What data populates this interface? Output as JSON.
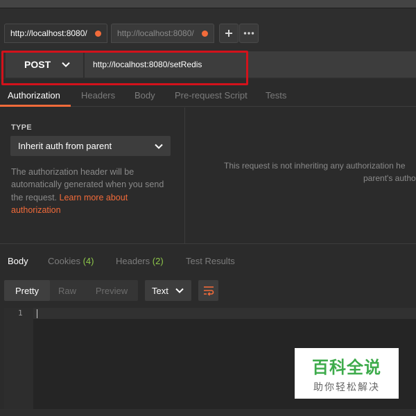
{
  "tabs": [
    {
      "label": "http://localhost:8080/",
      "active": true,
      "unsaved": true
    },
    {
      "label": "http://localhost:8080/",
      "active": false,
      "unsaved": true
    }
  ],
  "tab_actions": {
    "new_tab_icon": "plus-icon",
    "more_icon": "ellipsis-icon"
  },
  "request": {
    "method": "POST",
    "url": "http://localhost:8080/setRedis"
  },
  "request_tabs": [
    "Authorization",
    "Headers",
    "Body",
    "Pre-request Script",
    "Tests"
  ],
  "auth": {
    "type_label": "TYPE",
    "type_value": "Inherit auth from parent",
    "description": "The authorization header will be automatically generated when you send the request.",
    "learn_more": "Learn more about authorization",
    "not_inheriting_line1": "This request is not inheriting any authorization he",
    "not_inheriting_line2": "parent's autho"
  },
  "response_tabs": {
    "body": "Body",
    "cookies": "Cookies",
    "cookies_count": "(4)",
    "headers": "Headers",
    "headers_count": "(2)",
    "test_results": "Test Results"
  },
  "view_modes": [
    "Pretty",
    "Raw",
    "Preview"
  ],
  "format": "Text",
  "editor": {
    "line_number": "1"
  },
  "watermark": {
    "title": "百科全说",
    "subtitle": "助你轻松解决"
  },
  "colors": {
    "accent": "#f26b3a",
    "count_green": "#8ec74a",
    "highlight_red": "#d3121b",
    "watermark_green": "#3dab4b"
  }
}
